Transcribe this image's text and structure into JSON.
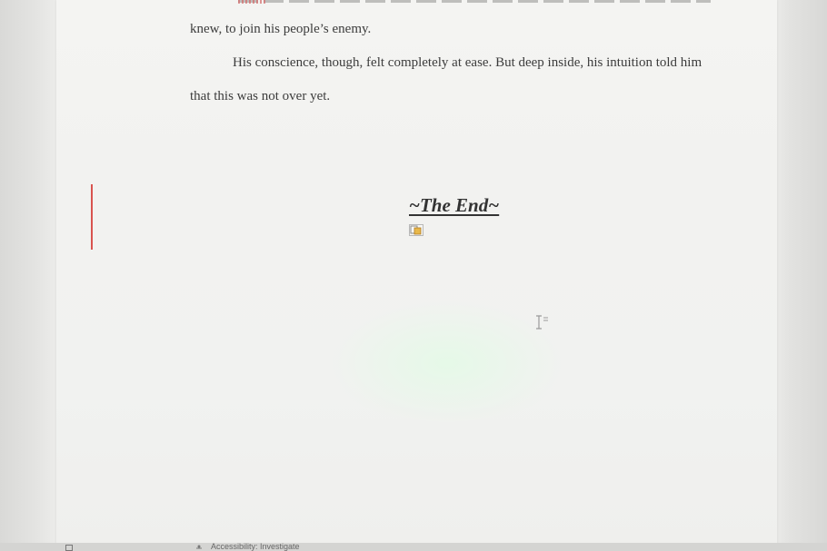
{
  "document": {
    "paragraphs": [
      "knew, to join his people’s enemy.",
      "His conscience, though, felt completely at ease. But deep inside, his intuition told him",
      "that this was not over yet."
    ],
    "ending_title": "~The End~"
  },
  "status_bar": {
    "accessibility_label": "Accessibility: Investigate"
  },
  "colors": {
    "change_bar": "#d9534f",
    "text": "#3c3c3c"
  },
  "icons": [
    "paste-options-icon",
    "ibeam-cursor-icon",
    "accessibility-icon",
    "view-icon"
  ]
}
